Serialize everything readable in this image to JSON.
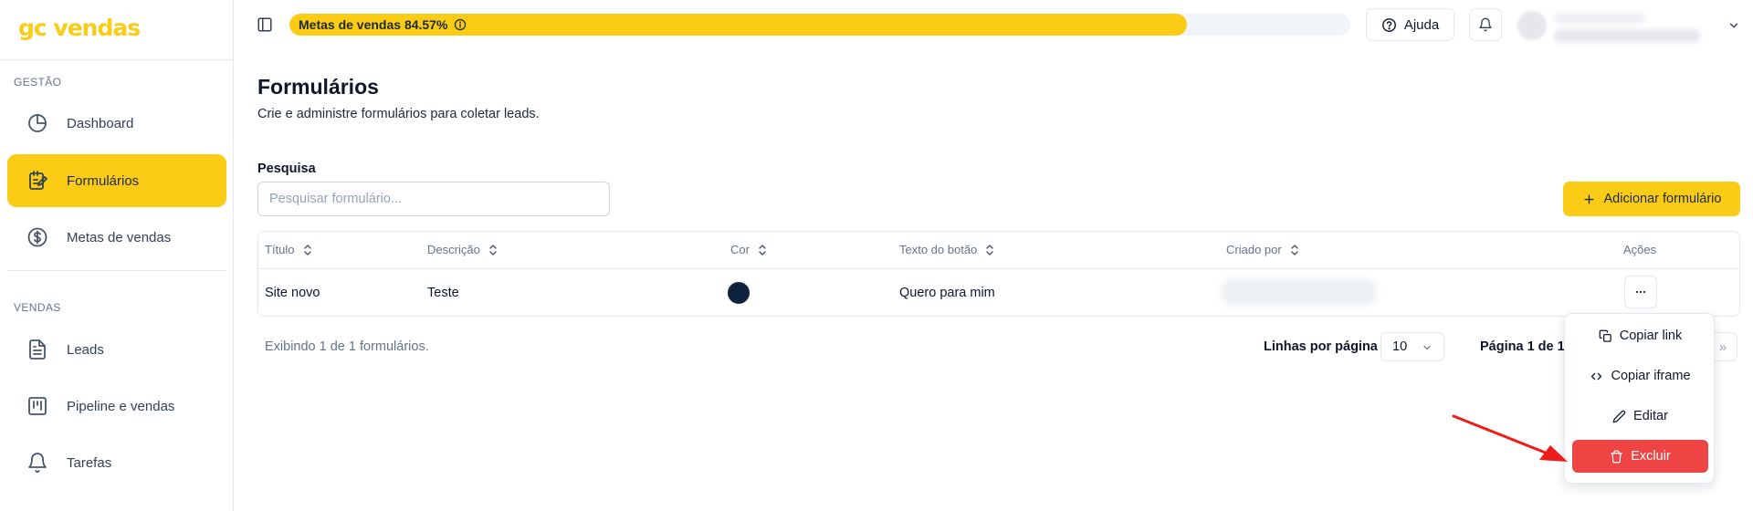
{
  "sidebar": {
    "logo": "gc vendas",
    "sections": [
      {
        "label": "GESTÃO"
      },
      {
        "label": "VENDAS"
      }
    ],
    "items": [
      {
        "label": "Dashboard",
        "icon": "pie-chart-icon"
      },
      {
        "label": "Formulários",
        "icon": "form-notebook-icon",
        "active": true
      },
      {
        "label": "Metas de vendas",
        "icon": "dollar-circle-icon"
      },
      {
        "label": "Leads",
        "icon": "document-icon"
      },
      {
        "label": "Pipeline e vendas",
        "icon": "kanban-icon"
      },
      {
        "label": "Tarefas",
        "icon": "bell-icon"
      }
    ]
  },
  "topbar": {
    "progress_label": "Metas de vendas 84.57%",
    "progress_percent": 84.57,
    "help_label": "Ajuda"
  },
  "page": {
    "title": "Formulários",
    "subtitle": "Crie e administre formulários para coletar leads.",
    "search_label": "Pesquisa",
    "search_placeholder": "Pesquisar formulário...",
    "add_button": "Adicionar formulário"
  },
  "table": {
    "columns": [
      "Título",
      "Descrição",
      "Cor",
      "Texto do botão",
      "Criado por",
      "Ações"
    ],
    "rows": [
      {
        "title": "Site novo",
        "description": "Teste",
        "color": "#0f2340",
        "button_text": "Quero para mim"
      }
    ]
  },
  "footer": {
    "showing": "Exibindo 1 de 1 formulários.",
    "rows_per_page_label": "Linhas por página",
    "rows_per_page_value": "10",
    "page_info": "Página 1 de 1",
    "last_page_symbol": "»"
  },
  "menu": {
    "items": [
      {
        "label": "Copiar link",
        "icon": "copy-icon"
      },
      {
        "label": "Copiar iframe",
        "icon": "code-icon"
      },
      {
        "label": "Editar",
        "icon": "pencil-icon"
      },
      {
        "label": "Excluir",
        "icon": "trash-icon",
        "danger": true
      }
    ]
  },
  "colors": {
    "accent": "#facc15",
    "danger": "#ef4444",
    "annotation": "#ef1c1c"
  }
}
